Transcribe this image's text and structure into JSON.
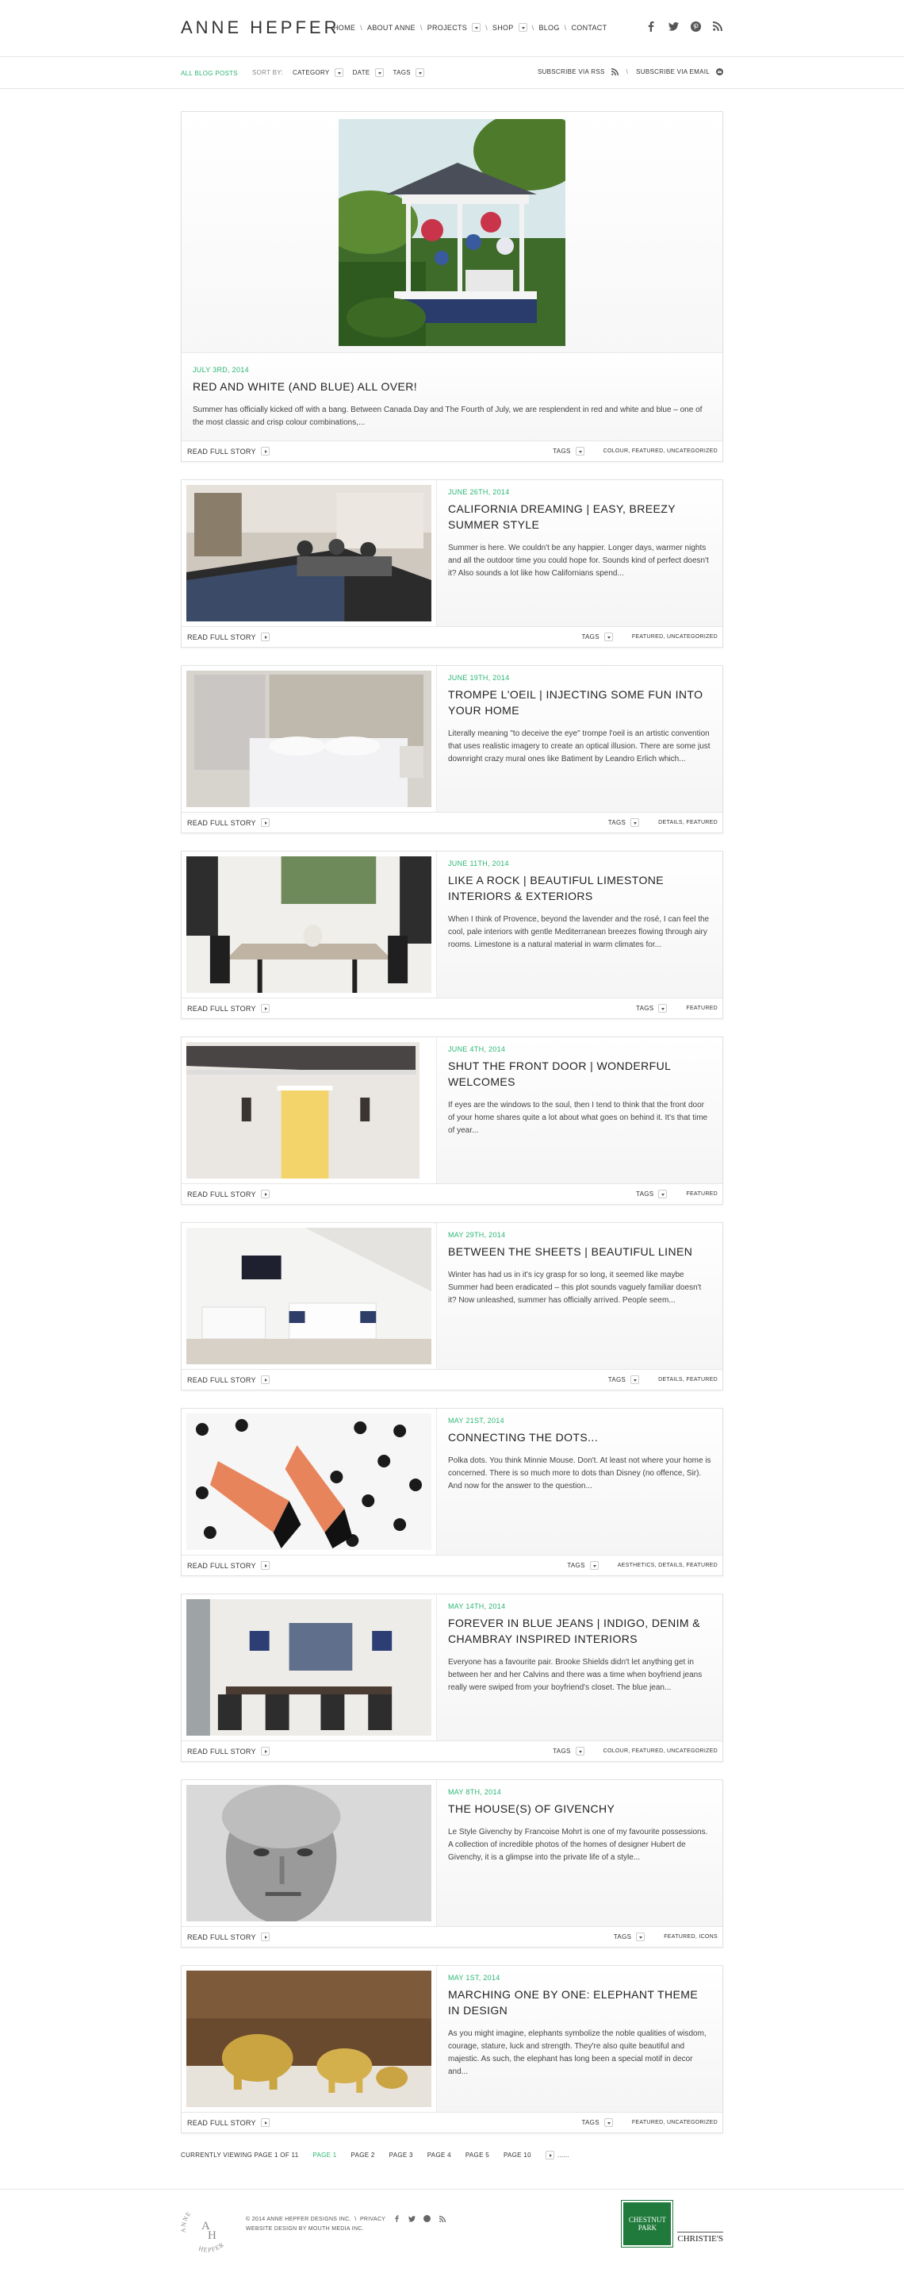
{
  "header": {
    "logo": "ANNE HEPFER",
    "nav": [
      {
        "label": "HOME",
        "dropdown": false
      },
      {
        "label": "ABOUT ANNE",
        "dropdown": false
      },
      {
        "label": "PROJECTS",
        "dropdown": true
      },
      {
        "label": "SHOP",
        "dropdown": true
      },
      {
        "label": "BLOG",
        "dropdown": false
      },
      {
        "label": "CONTACT",
        "dropdown": false
      }
    ],
    "social_icons": [
      "facebook-icon",
      "twitter-icon",
      "pinterest-icon",
      "rss-icon"
    ]
  },
  "filterbar": {
    "all_posts": "ALL BLOG POSTS",
    "sort_label": "SORT BY:",
    "sort_options": [
      "CATEGORY",
      "DATE",
      "TAGS"
    ],
    "subscribe_rss": "SUBSCRIBE VIA RSS",
    "subscribe_email": "SUBSCRIBE VIA EMAIL"
  },
  "labels": {
    "read_more": "READ FULL STORY",
    "tags": "TAGS"
  },
  "posts": [
    {
      "date": "JULY 3RD, 2014",
      "title": "RED AND WHITE (AND BLUE) ALL OVER!",
      "excerpt": "Summer has officially kicked off with a bang. Between Canada Day and The Fourth of July, we are resplendent in red and white and blue – one of the most classic and crisp colour combinations,...",
      "categories": "COLOUR, FEATURED, UNCATEGORIZED"
    },
    {
      "date": "JUNE 26TH, 2014",
      "title": "CALIFORNIA DREAMING | EASY, BREEZY SUMMER STYLE",
      "excerpt": "Summer is here. We couldn't be any happier. Longer days, warmer nights and all the outdoor time you could hope for. Sounds kind of perfect doesn't it? Also sounds a lot like how Californians spend...",
      "categories": "FEATURED, UNCATEGORIZED"
    },
    {
      "date": "JUNE 19TH, 2014",
      "title": "TROMPE L'OEIL | INJECTING SOME FUN INTO YOUR HOME",
      "excerpt": "Literally meaning \"to deceive the eye\" trompe l'oeil is an artistic convention that uses realistic imagery to create an optical illusion. There are some just downright crazy mural ones like Batiment by Leandro Erlich which...",
      "categories": "DETAILS, FEATURED"
    },
    {
      "date": "JUNE 11TH, 2014",
      "title": "LIKE A ROCK | BEAUTIFUL LIMESTONE INTERIORS & EXTERIORS",
      "excerpt": "When I think of Provence, beyond the lavender and the rosé, I can feel the cool, pale interiors with gentle Mediterranean breezes flowing through airy rooms. Limestone is a natural material in warm climates for...",
      "categories": "FEATURED"
    },
    {
      "date": "JUNE 4TH, 2014",
      "title": "SHUT THE FRONT DOOR | WONDERFUL WELCOMES",
      "excerpt": "If eyes are the windows to the soul, then I tend to think that the front door of your home shares quite a lot about what goes on behind it. It's that time of year...",
      "categories": "FEATURED"
    },
    {
      "date": "MAY 29TH, 2014",
      "title": "BETWEEN THE SHEETS | BEAUTIFUL LINEN",
      "excerpt": "Winter has had us in it's icy grasp for so long, it seemed like maybe Summer had been eradicated – this plot sounds vaguely familiar doesn't it? Now unleashed, summer has officially arrived. People seem...",
      "categories": "DETAILS, FEATURED"
    },
    {
      "date": "MAY 21ST, 2014",
      "title": "CONNECTING THE DOTS...",
      "excerpt": "Polka dots. You think Minnie Mouse. Don't. At least not where your home is concerned. There is so much more to dots than Disney (no offence, Sir). And now for the answer to the question...",
      "categories": "AESTHETICS, DETAILS, FEATURED"
    },
    {
      "date": "MAY 14TH, 2014",
      "title": "FOREVER IN BLUE JEANS | INDIGO, DENIM & CHAMBRAY INSPIRED INTERIORS",
      "excerpt": "Everyone has a favourite pair. Brooke Shields didn't let anything get in between her and her Calvins and there was a time when boyfriend jeans really were swiped from your boyfriend's closet. The blue jean...",
      "categories": "COLOUR, FEATURED, UNCATEGORIZED"
    },
    {
      "date": "MAY 8TH, 2014",
      "title": "THE HOUSE(S) OF GIVENCHY",
      "excerpt": "Le Style Givenchy by Francoise Mohrt is one of my favourite possessions. A collection of incredible photos of the homes of designer Hubert de Givenchy, it is a glimpse into the private life of a style...",
      "categories": "FEATURED, ICONS"
    },
    {
      "date": "MAY 1ST, 2014",
      "title": "MARCHING ONE BY ONE: ELEPHANT THEME IN DESIGN",
      "excerpt": "As you might imagine, elephants symbolize the noble qualities of wisdom, courage, stature, luck and strength. They're also quite beautiful and majestic. As such, the elephant has long been a special motif in decor and...",
      "categories": "FEATURED, UNCATEGORIZED"
    }
  ],
  "pagination": {
    "current": "CURRENTLY VIEWING PAGE 1 OF 11",
    "pages": [
      "PAGE 1",
      "PAGE 2",
      "PAGE 3",
      "PAGE 4",
      "PAGE 5",
      "PAGE 10"
    ],
    "active_page": "PAGE 1",
    "more": "......"
  },
  "footer": {
    "logo_text": "ANNE HEPFER",
    "copyright": "© 2014 ANNE HEPFER DESIGNS INC.",
    "privacy": "PRIVACY",
    "credit": "WEBSITE DESIGN BY MOUTH MEDIA INC.",
    "brand1_line1": "CHESTNUT",
    "brand1_line2": "PARK",
    "brand2": "CHRISTIE'S"
  },
  "colors": {
    "accent": "#2bb673",
    "border": "#e2e2e2",
    "text": "#333333"
  }
}
